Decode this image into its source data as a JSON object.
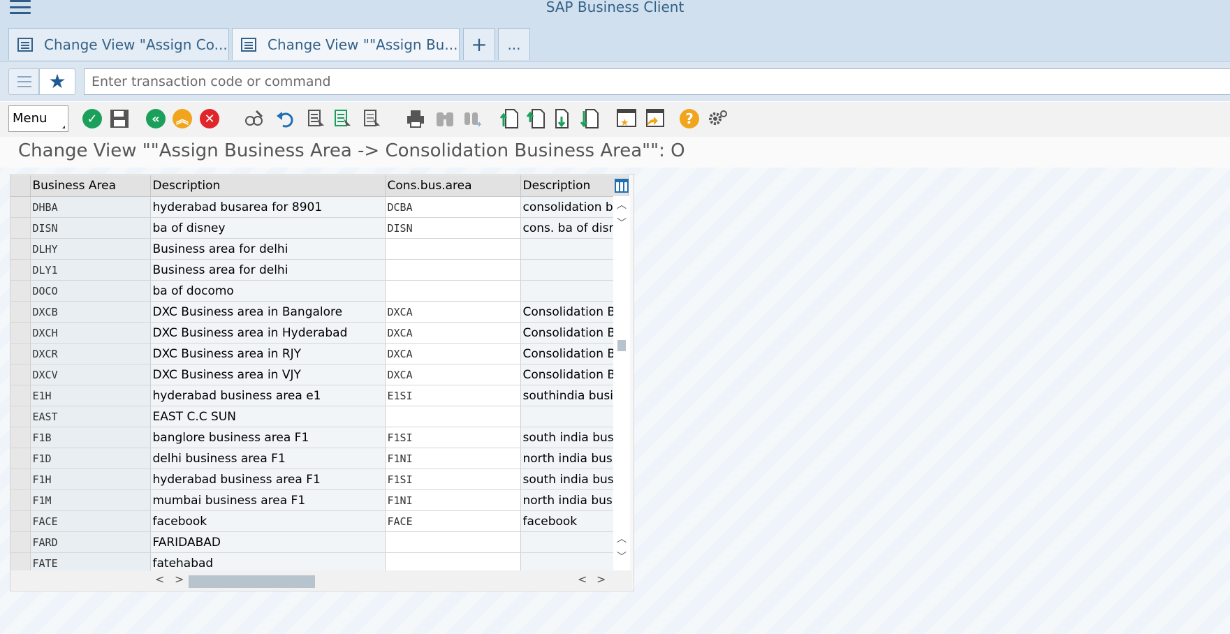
{
  "app": {
    "title": "SAP Business Client"
  },
  "tabs": [
    {
      "label": "Change View \"Assign Co...",
      "active": false
    },
    {
      "label": "Change View \"\"Assign Bu...",
      "active": true
    }
  ],
  "tab_actions": {
    "add": "+",
    "more": "..."
  },
  "command": {
    "placeholder": "Enter transaction code or command",
    "value": ""
  },
  "toolbar": {
    "menu_label": "Menu",
    "icons": [
      "enter-icon",
      "save-icon",
      "back-icon",
      "exit-icon",
      "cancel-icon",
      "display-change-icon",
      "undo-icon",
      "select-all-icon",
      "select-block-icon",
      "deselect-icon",
      "print-icon",
      "find-icon",
      "find-next-icon",
      "first-page-icon",
      "previous-page-icon",
      "next-page-icon",
      "last-page-icon",
      "create-session-icon",
      "shortcut-icon",
      "help-icon",
      "settings-icon"
    ],
    "colors": {
      "green": "#1aa05a",
      "yellow": "#f0a51c",
      "red": "#e0262b",
      "blue": "#1f6fb5"
    }
  },
  "page": {
    "heading": "Change View \"\"Assign Business Area -> Consolidation Business Area\"\": O"
  },
  "table": {
    "columns": [
      "Business Area",
      "Description",
      "Cons.bus.area",
      "Description"
    ],
    "rows": [
      [
        "DHBA",
        "hyderabad busarea for 8901",
        "DCBA",
        "consolidation bu"
      ],
      [
        "DISN",
        "ba of disney",
        "DISN",
        "cons. ba of disne"
      ],
      [
        "DLHY",
        "Business area for delhi",
        "",
        ""
      ],
      [
        "DLY1",
        "Business area for delhi",
        "",
        ""
      ],
      [
        "DOCO",
        "ba of docomo",
        "",
        ""
      ],
      [
        "DXCB",
        "DXC Business area in Bangalore",
        "DXCA",
        "Consolidation Bu"
      ],
      [
        "DXCH",
        "DXC Business area in Hyderabad",
        "DXCA",
        "Consolidation Bu"
      ],
      [
        "DXCR",
        "DXC Business area in RJY",
        "DXCA",
        "Consolidation Bu"
      ],
      [
        "DXCV",
        "DXC Business area in VJY",
        "DXCA",
        "Consolidation Bu"
      ],
      [
        "E1H",
        "hyderabad business area e1",
        "E1SI",
        "southindia busine"
      ],
      [
        "EAST",
        "EAST C.C SUN",
        "",
        ""
      ],
      [
        "F1B",
        "banglore business area F1",
        "F1SI",
        "south india busin"
      ],
      [
        "F1D",
        "delhi business area F1",
        "F1NI",
        "north india busin"
      ],
      [
        "F1H",
        "hyderabad business area F1",
        "F1SI",
        "south india busin"
      ],
      [
        "F1M",
        "mumbai business area F1",
        "F1NI",
        "north india busin"
      ],
      [
        "FACE",
        "facebook",
        "FACE",
        "facebook"
      ],
      [
        "FARD",
        "FARIDABAD",
        "",
        ""
      ],
      [
        "FATE",
        "fatehabad",
        "",
        ""
      ]
    ]
  }
}
